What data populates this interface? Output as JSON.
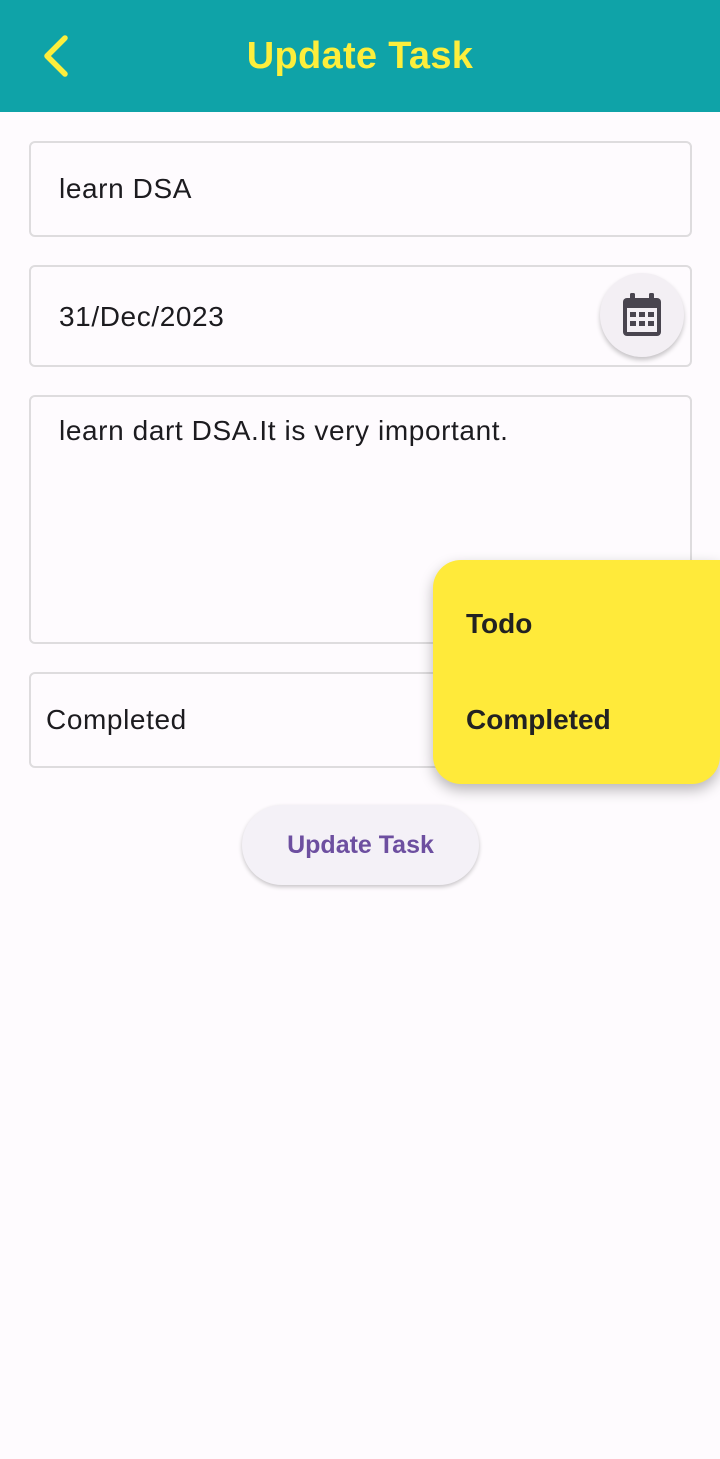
{
  "appbar": {
    "title": "Update Task",
    "back_icon": "chevron-left-icon",
    "background": "#0fa3a8",
    "title_color": "#fdee3c"
  },
  "form": {
    "title_value": "learn DSA",
    "date_value": "31/Dec/2023",
    "calendar_icon": "calendar-icon",
    "description_value": "learn dart DSA.It is very important.",
    "status_value": "Completed"
  },
  "status_menu": {
    "background": "#ffea3a",
    "options": [
      "Todo",
      "Completed"
    ]
  },
  "submit_button": {
    "label": "Update Task",
    "color": "#6d4fa0"
  }
}
